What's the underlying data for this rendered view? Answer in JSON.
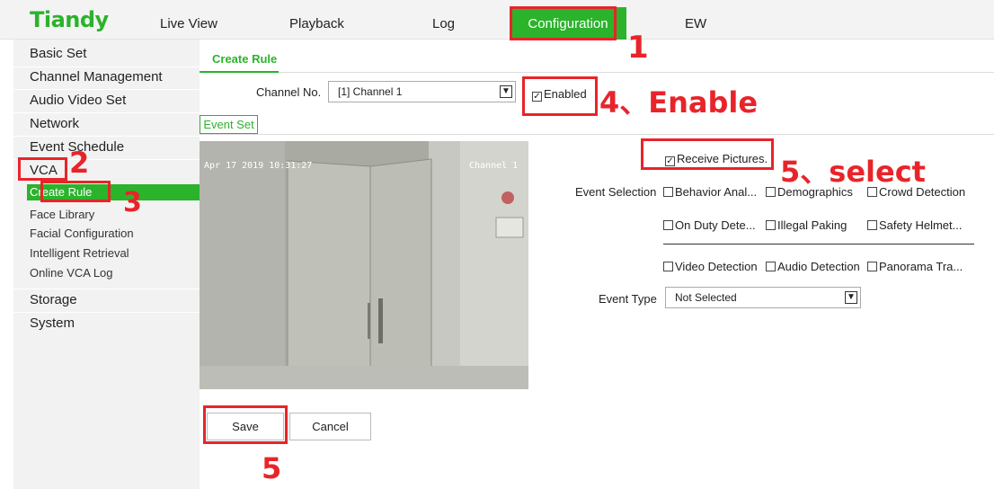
{
  "header": {
    "logo": "Tiandy",
    "nav": [
      "Live View",
      "Playback",
      "Log",
      "Configuration",
      "EW"
    ],
    "active": "Configuration"
  },
  "sidebar": {
    "items": [
      "Basic Set",
      "Channel Management",
      "Audio Video Set",
      "Network",
      "Event Schedule",
      "VCA"
    ],
    "vca_sub": [
      "Create Rule",
      "Face Library",
      "Facial Configuration",
      "Intelligent Retrieval",
      "Online VCA Log"
    ],
    "active_sub": "Create Rule",
    "bottom": [
      "Storage",
      "System"
    ]
  },
  "main": {
    "tab": "Create Rule",
    "channel_label": "Channel No.",
    "channel_value": "[1] Channel 1",
    "enabled_label": "Enabled",
    "enabled_checked": true,
    "event_set": "Event Set",
    "video": {
      "timestamp": "Apr 17 2019 10:31:27",
      "channel": "Channel 1"
    },
    "receive_pictures": "Receive Pictures.",
    "receive_checked": true,
    "event_selection_label": "Event Selection",
    "events_row1": [
      "Behavior Anal...",
      "Demographics",
      "Crowd Detection"
    ],
    "events_row2": [
      "On Duty Dete...",
      "Illegal Paking",
      "Safety Helmet..."
    ],
    "events_row3": [
      "Video Detection",
      "Audio Detection",
      "Panorama Tra..."
    ],
    "event_type_label": "Event Type",
    "event_type_value": "Not Selected",
    "save": "Save",
    "cancel": "Cancel"
  },
  "annotations": {
    "n1": "1",
    "n2": "2",
    "n3": "3",
    "n4": "4、Enable",
    "n5_select": "5、select",
    "n5": "5"
  },
  "colors": {
    "accent": "#2bb32b",
    "annotation": "#e8242a"
  }
}
